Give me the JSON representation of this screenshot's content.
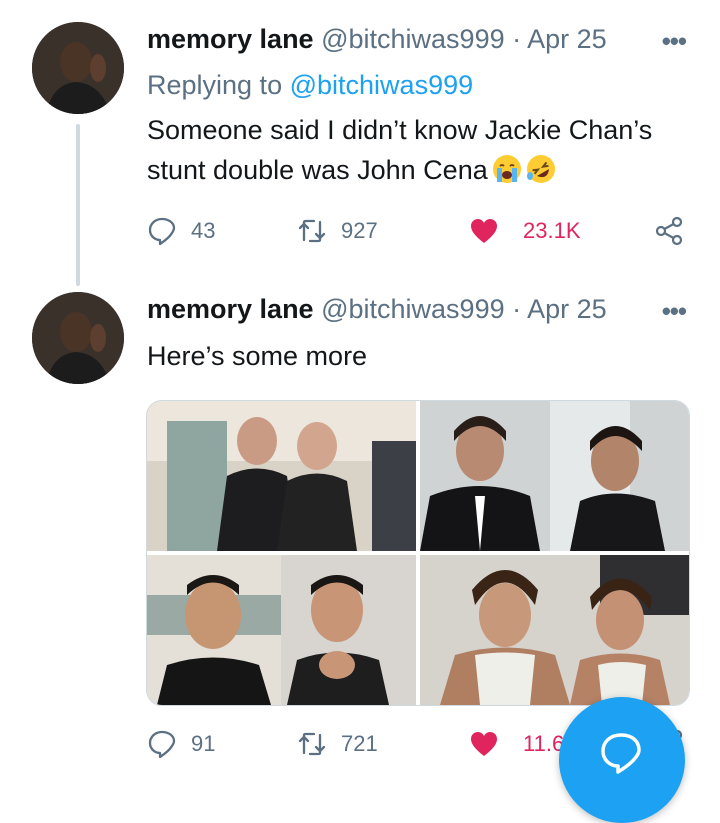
{
  "tweets": [
    {
      "name": "memory lane",
      "handle": "@bitchiwas999",
      "separator": "·",
      "date": "Apr 25",
      "replying_prefix": "Replying to",
      "replying_handle": "@bitchiwas999",
      "text_line1": "Someone said I didn’t know Jackie Chan’s",
      "text_line2": "stunt double was John Cena",
      "emojis": [
        "loudly-crying-face",
        "rolling-on-floor-laughing"
      ],
      "replies": "43",
      "retweets": "927",
      "likes": "23.1K",
      "liked": true
    },
    {
      "name": "memory lane",
      "handle": "@bitchiwas999",
      "separator": "·",
      "date": "Apr 25",
      "text": "Here’s some more",
      "media_count": 4,
      "replies": "91",
      "retweets": "721",
      "likes": "11.6",
      "liked": true
    }
  ],
  "icons": {
    "reply": "speech-bubble",
    "retweet": "retweet-arrows",
    "like": "heart",
    "share": "share-nodes",
    "more": "three-dots",
    "compose": "compose-bubble"
  },
  "more_label": "•••",
  "colors": {
    "accent": "#1da1f2",
    "like": "#e0245e",
    "secondary_text": "#5b7083",
    "primary_text": "#14171a"
  }
}
